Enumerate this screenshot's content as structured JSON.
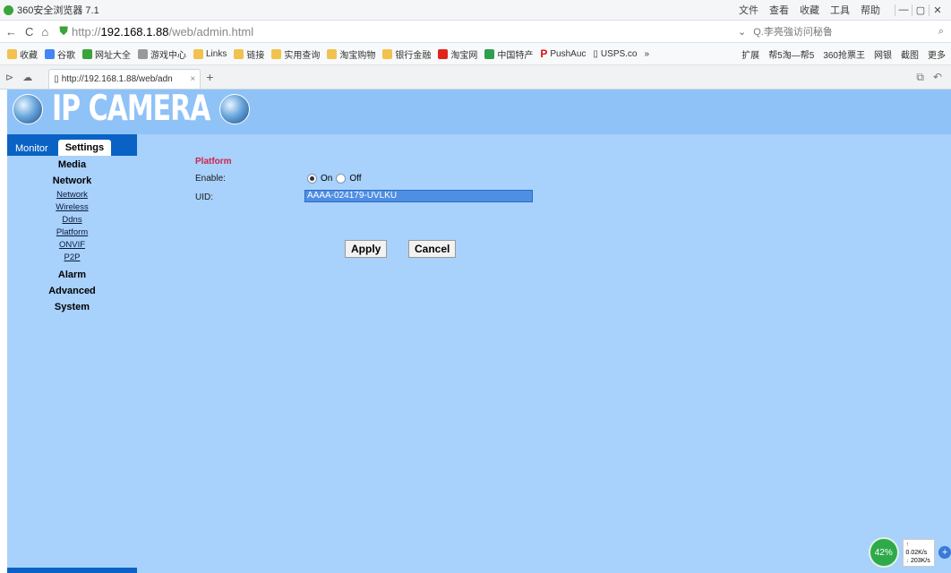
{
  "browser": {
    "title": "360安全浏览器 7.1",
    "menu": [
      "文件",
      "查看",
      "收藏",
      "工具",
      "帮助"
    ],
    "url": {
      "proto": "http://",
      "host": "192.168.1.88",
      "path": "/web/admin.html"
    },
    "search_placeholder": "Q.李亮強访问秘鲁",
    "bookmarks_left": [
      "收藏",
      "谷歌",
      "网址大全",
      "游戏中心",
      "Links",
      "链接",
      "实用查询",
      "淘宝购物",
      "银行金融",
      "淘宝网",
      "中国特产",
      "PushAuc",
      "USPS.co"
    ],
    "bookmarks_right": [
      "扩展",
      "帮5淘—帮5",
      "360抢票王",
      "网银",
      "截图",
      "更多"
    ],
    "tab_title": "http://192.168.1.88/web/adn",
    "close_glyph": "×",
    "new_tab_glyph": "+"
  },
  "app": {
    "brand": "IP CAMERA",
    "tabs": [
      {
        "label": "Monitor"
      },
      {
        "label": "Settings"
      }
    ],
    "menu": {
      "media": "Media",
      "network": "Network",
      "network_items": [
        "Network",
        "Wireless",
        "Ddns",
        "Platform",
        "ONVIF",
        "P2P"
      ],
      "alarm": "Alarm",
      "advanced": "Advanced",
      "system": "System"
    },
    "form": {
      "section": "Platform",
      "enable_label": "Enable:",
      "on_label": "On",
      "off_label": "Off",
      "enable_value": "On",
      "uid_label": "UID:",
      "uid_value": "AAAA-024179-UVLKU",
      "apply": "Apply",
      "cancel": "Cancel"
    },
    "colors": {
      "header": "#8fc2f7",
      "page_bg": "#a8d1fb",
      "sidebar": "#0a63c4",
      "section_title": "#d1234b"
    }
  },
  "netmon": {
    "cpu": "42%",
    "up": "0.02K/s",
    "down": "203K/s"
  }
}
